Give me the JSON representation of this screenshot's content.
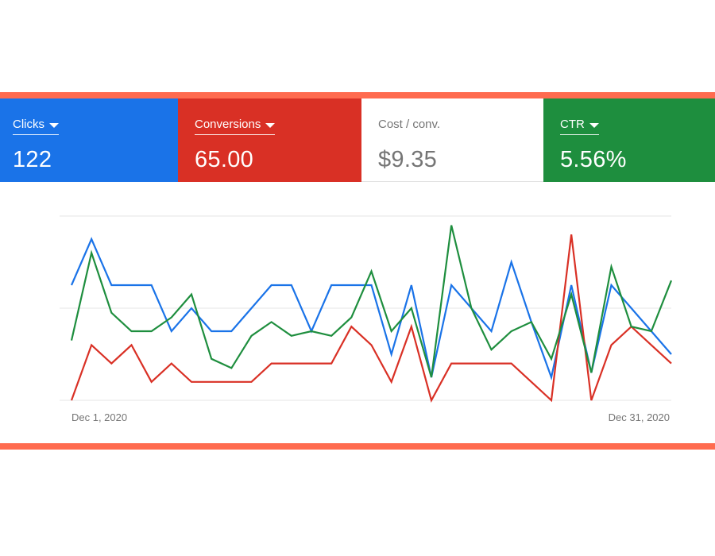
{
  "colors": {
    "clicks": "#1a73e8",
    "conversions": "#d93025",
    "cost": "#ffffff",
    "ctr": "#1e8e3e",
    "border": "#ff6b4f",
    "grid": "#e6e6e6",
    "muted_text": "#757575"
  },
  "metrics": [
    {
      "id": "clicks",
      "label": "Clicks",
      "value": "122",
      "dropdown": true,
      "icon": "caret-down-icon"
    },
    {
      "id": "conversions",
      "label": "Conversions",
      "value": "65.00",
      "dropdown": true,
      "icon": "caret-down-icon"
    },
    {
      "id": "cost",
      "label": "Cost / conv.",
      "value": "$9.35",
      "dropdown": false
    },
    {
      "id": "ctr",
      "label": "CTR",
      "value": "5.56%",
      "dropdown": true,
      "icon": "caret-down-icon"
    }
  ],
  "chart_data": {
    "type": "line",
    "x": [
      1,
      2,
      3,
      4,
      5,
      6,
      7,
      8,
      9,
      10,
      11,
      12,
      13,
      14,
      15,
      16,
      17,
      18,
      19,
      20,
      21,
      22,
      23,
      24,
      25,
      26,
      27,
      28,
      29,
      30,
      31
    ],
    "x_tick_labels": [
      {
        "x": 1,
        "label": "Dec 1, 2020"
      },
      {
        "x": 31,
        "label": "Dec 31, 2020"
      }
    ],
    "ylim": [
      0,
      4
    ],
    "grid": true,
    "series": [
      {
        "id": "clicks",
        "color": "#1a73e8",
        "values": [
          2.5,
          3.5,
          2.5,
          2.5,
          2.5,
          1.5,
          2.0,
          1.5,
          1.5,
          2.0,
          2.5,
          2.5,
          1.5,
          2.5,
          2.5,
          2.5,
          1.0,
          2.5,
          0.5,
          2.5,
          2.0,
          1.5,
          3.0,
          1.7,
          0.5,
          2.5,
          0.6,
          2.5,
          2.0,
          1.5,
          1.0
        ]
      },
      {
        "id": "conversions",
        "color": "#d93025",
        "values": [
          0.0,
          1.2,
          0.8,
          1.2,
          0.4,
          0.8,
          0.4,
          0.4,
          0.4,
          0.4,
          0.8,
          0.8,
          0.8,
          0.8,
          1.6,
          1.2,
          0.4,
          1.6,
          0.0,
          0.8,
          0.8,
          0.8,
          0.8,
          0.4,
          0.0,
          3.6,
          0.0,
          1.2,
          1.6,
          1.2,
          0.8
        ]
      },
      {
        "id": "ctr",
        "color": "#1e8e3e",
        "values": [
          1.3,
          3.2,
          1.9,
          1.5,
          1.5,
          1.8,
          2.3,
          0.9,
          0.7,
          1.4,
          1.7,
          1.4,
          1.5,
          1.4,
          1.8,
          2.8,
          1.5,
          2.0,
          0.5,
          3.8,
          2.0,
          1.1,
          1.5,
          1.7,
          0.9,
          2.3,
          0.6,
          2.9,
          1.6,
          1.5,
          2.6
        ]
      }
    ]
  }
}
